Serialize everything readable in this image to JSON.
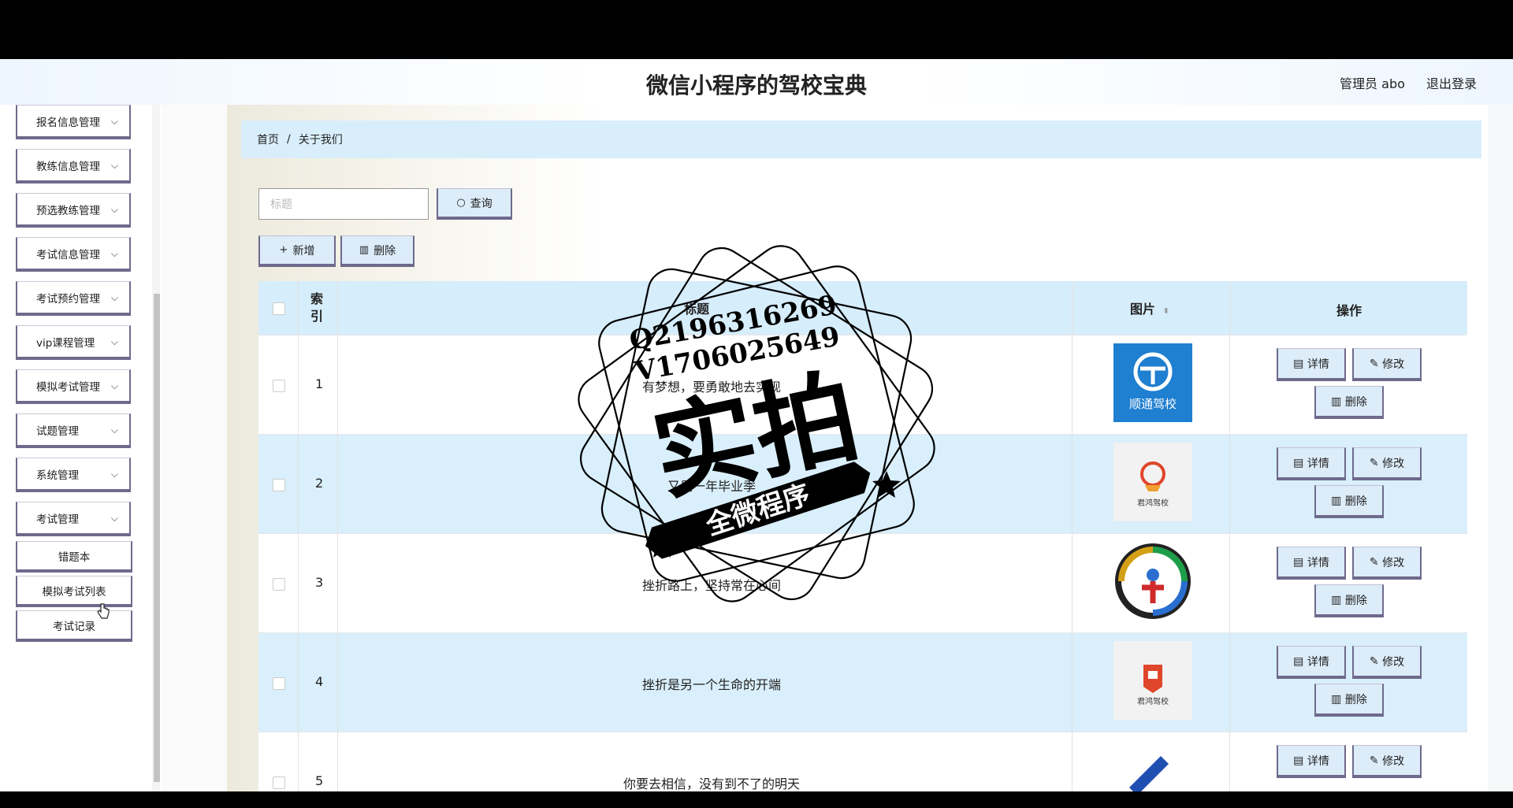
{
  "header": {
    "title": "微信小程序的驾校宝典",
    "user_label": "管理员 abo",
    "logout": "退出登录"
  },
  "sidebar": {
    "items": [
      {
        "label": "报名信息管理"
      },
      {
        "label": "教练信息管理"
      },
      {
        "label": "预选教练管理"
      },
      {
        "label": "考试信息管理"
      },
      {
        "label": "考试预约管理"
      },
      {
        "label": "vip课程管理"
      },
      {
        "label": "模拟考试管理"
      },
      {
        "label": "试题管理"
      },
      {
        "label": "系统管理"
      },
      {
        "label": "考试管理"
      }
    ],
    "sub_items": [
      {
        "label": "错题本"
      },
      {
        "label": "模拟考试列表"
      },
      {
        "label": "考试记录"
      }
    ],
    "chevron": "⌄"
  },
  "breadcrumb": {
    "home": "首页",
    "separator": "/",
    "current": "关于我们"
  },
  "search": {
    "placeholder": "标题",
    "button": "查询"
  },
  "toolbar": {
    "add": "新增",
    "delete": "删除"
  },
  "table": {
    "headers": {
      "index": "索\n引",
      "title": "标题",
      "image": "图片",
      "actions": "操作"
    },
    "rows": [
      {
        "index": "1",
        "title": "有梦想，要勇敢地去实现"
      },
      {
        "index": "2",
        "title": "又是一年毕业季"
      },
      {
        "index": "3",
        "title": "挫折路上，坚持常在心间"
      },
      {
        "index": "4",
        "title": "挫折是另一个生命的开端"
      },
      {
        "index": "5",
        "title": "你要去相信，没有到不了的明天"
      }
    ],
    "actions": {
      "detail": "详情",
      "edit": "修改",
      "delete": "删除"
    }
  },
  "images": {
    "row1_logo_text": "顺通驾校",
    "row2_logo_text": "君鸿驾校",
    "row4_logo_text": "君鸿驾校"
  },
  "watermark": {
    "qq": "Q2196316269",
    "wx": "V1706025649",
    "main": "实拍",
    "ribbon": "全微程序"
  },
  "colors": {
    "accent_light": "#d9effb",
    "button_border": "#6e6a8c",
    "logo_blue": "#1f7fd0"
  }
}
